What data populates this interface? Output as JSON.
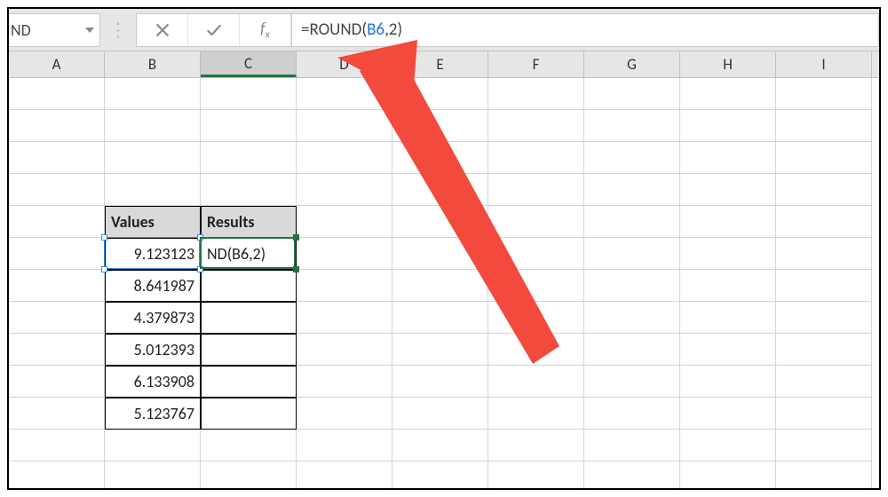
{
  "name_box": {
    "value": "ND"
  },
  "formula_bar": {
    "prefix": "=ROUND(",
    "ref": "B6",
    "suffix": ",2)"
  },
  "columns": [
    "A",
    "B",
    "C",
    "D",
    "E",
    "F",
    "G",
    "H",
    "I"
  ],
  "selected_column": "C",
  "table": {
    "headers": {
      "b": "Values",
      "c": "Results"
    },
    "rows": [
      {
        "value": "9.123123",
        "result_display": "ND(B6,2)"
      },
      {
        "value": "8.641987",
        "result_display": ""
      },
      {
        "value": "4.379873",
        "result_display": ""
      },
      {
        "value": "5.012393",
        "result_display": ""
      },
      {
        "value": "6.133908",
        "result_display": ""
      },
      {
        "value": "5.123767",
        "result_display": ""
      }
    ]
  },
  "colors": {
    "excel_green": "#217346",
    "ref_blue": "#3b8ee0",
    "arrow_red": "#f24a3d"
  }
}
